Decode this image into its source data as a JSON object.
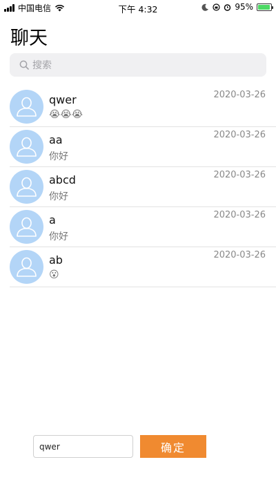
{
  "status_bar": {
    "carrier": "中国电信",
    "time": "下午 4:32",
    "battery_percent": "95%",
    "battery_level": 0.95
  },
  "header": {
    "title": "聊天"
  },
  "search": {
    "placeholder": "搜索"
  },
  "chats": [
    {
      "name": "qwer",
      "message": "😭😭😭",
      "date": "2020-03-26"
    },
    {
      "name": "aa",
      "message": "你好",
      "date": "2020-03-26"
    },
    {
      "name": "abcd",
      "message": "你好",
      "date": "2020-03-26"
    },
    {
      "name": "a",
      "message": "你好",
      "date": "2020-03-26"
    },
    {
      "name": "ab",
      "message": "😮",
      "date": "2020-03-26"
    }
  ],
  "composer": {
    "input_value": "qwer",
    "confirm_label": "确定"
  },
  "colors": {
    "avatar_bg": "#b3d5f7",
    "confirm_bg": "#f08a30",
    "search_bg": "#f0f0f2"
  }
}
